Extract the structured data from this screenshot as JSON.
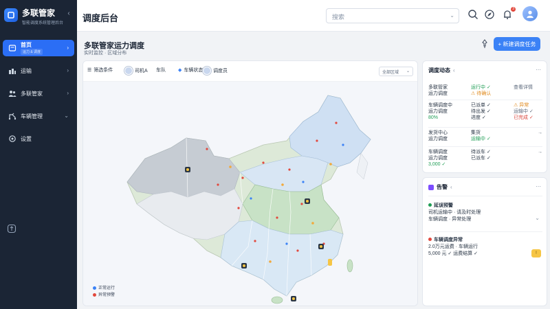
{
  "brand": {
    "title": "多联管家",
    "subtitle": "智能调度系统管理后台"
  },
  "sidebar": {
    "items": [
      {
        "label": "首页",
        "sublabel": "运力 & 调度",
        "icon": "home-icon",
        "active": true
      },
      {
        "label": "运输",
        "icon": "route-icon",
        "active": false
      },
      {
        "label": "多联管家",
        "icon": "users-icon",
        "active": false
      },
      {
        "label": "车辆管理",
        "icon": "truck-icon",
        "active": false
      },
      {
        "label": "设置",
        "icon": "gear-icon",
        "active": false
      }
    ]
  },
  "topbar": {
    "heading": "调度后台",
    "search_placeholder": "搜索",
    "notification_count": "3"
  },
  "main": {
    "title": "多联管家运力调度",
    "subtitle": "实时监控 · 区域分布",
    "primary_button": "+ 新建调度任务"
  },
  "map": {
    "toolbar": {
      "chip1": "筛选条件",
      "chip2": "司机A",
      "chip3": "车队",
      "chip4": "车辆状态",
      "chip5": "调度员",
      "select": "全部区域"
    },
    "legend": [
      {
        "label": "正常运行",
        "color": "#3b82f6"
      },
      {
        "label": "异常预警",
        "color": "#e2483d"
      }
    ],
    "marker_label": "调度点"
  },
  "dispatch_panel": {
    "title": "调度动态",
    "rows": [
      {
        "c1": "多联管家",
        "c1b": "运力调度",
        "c2": "运行中 ✓",
        "c2b": "⚠ 待确认",
        "c3": "查看详情"
      },
      {
        "c1": "车辆调度中",
        "c1b": "运力调度",
        "c1c": "80%",
        "c2": "已派单 ✓",
        "c2b": "待出发 ✓",
        "c2c": "进度 ✓",
        "c3": "⚠ 异常",
        "c3b": "运输中 ✓",
        "c3c": "已完成 ✓"
      },
      {
        "c1": "发货中心",
        "c1b": "运力调度",
        "c2": "集货",
        "c2b": "运输中 ✓",
        "c3": "→"
      },
      {
        "c1": "车辆调度",
        "c1b": "运力调度",
        "c1c": "3,000 ✓",
        "c2": "待派车 ✓",
        "c2b": "已派车 ✓",
        "c3": "→"
      }
    ]
  },
  "alert_panel": {
    "title": "告警",
    "items": [
      {
        "title": "延误预警",
        "line1": "司机运输中 · 请及时处理",
        "line2": "车辆调度 · 异常处理"
      },
      {
        "title": "车辆调度异常",
        "line1": "2.0万元运费 · 车辆运行",
        "line2": "5,000 元 ✓ 运费结算 ✓",
        "badge": "!"
      }
    ]
  },
  "colors": {
    "sidebar_bg": "#1b2535",
    "accent": "#3b82f6",
    "alert": "#e2483d",
    "warning": "#f6c544"
  }
}
